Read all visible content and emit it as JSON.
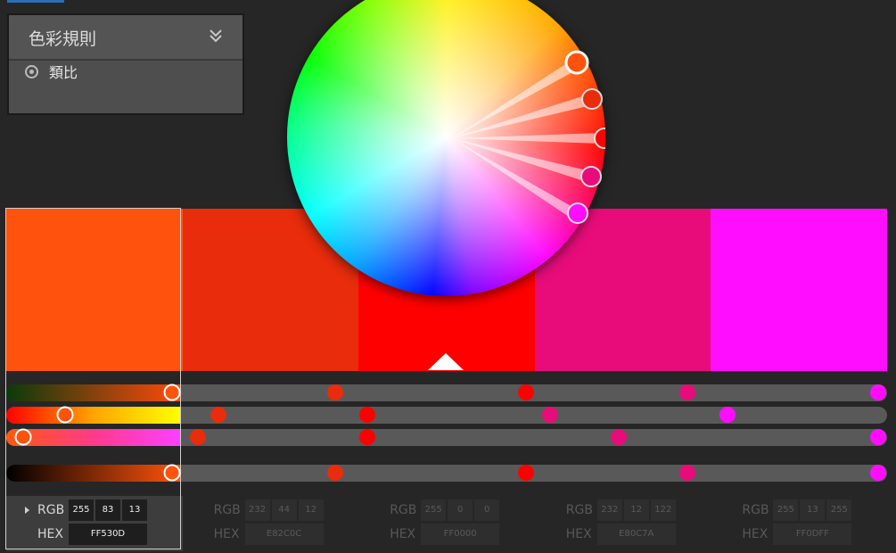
{
  "rule_panel": {
    "title": "色彩規則",
    "option": "類比"
  },
  "swatches": [
    {
      "hex": "FF530D",
      "rgb": [
        "255",
        "83",
        "13"
      ],
      "color": "#ff530d"
    },
    {
      "hex": "E82C0C",
      "rgb": [
        "232",
        "44",
        "12"
      ],
      "color": "#e82c0c"
    },
    {
      "hex": "FF0000",
      "rgb": [
        "255",
        "0",
        "0"
      ],
      "color": "#ff0000"
    },
    {
      "hex": "E80C7A",
      "rgb": [
        "232",
        "12",
        "122"
      ],
      "color": "#e80c7a"
    },
    {
      "hex": "FF0DFF",
      "rgb": [
        "255",
        "13",
        "255"
      ],
      "color": "#ff0dff"
    }
  ],
  "labels": {
    "rgb": "RGB",
    "hex": "HEX"
  },
  "icons": {
    "collapse": "double-chevron-down-icon",
    "expand": "triangle-right-icon",
    "radio": "radio-selected-icon"
  }
}
